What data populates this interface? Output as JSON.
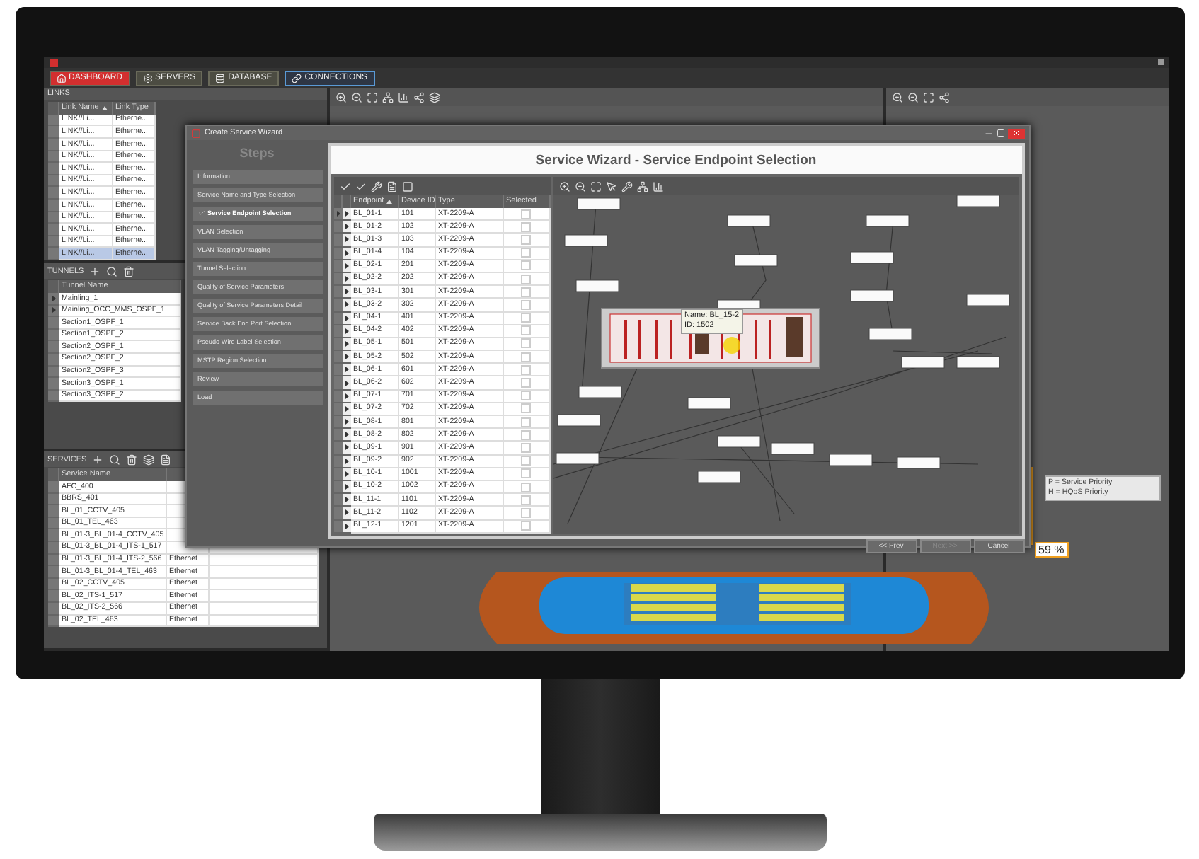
{
  "nav_tabs": [
    {
      "label": "DASHBOARD",
      "kind": "home",
      "selected": false
    },
    {
      "label": "SERVERS",
      "kind": "gear",
      "selected": false
    },
    {
      "label": "DATABASE",
      "kind": "database",
      "selected": false
    },
    {
      "label": "CONNECTIONS",
      "kind": "link",
      "selected": true
    }
  ],
  "links_panel": {
    "title": "LINKS",
    "columns": [
      "Link Name",
      "Link Type"
    ],
    "rows": [
      {
        "name": "LINK//Li...",
        "type": "Etherne...",
        "selected": false
      },
      {
        "name": "LINK//Li...",
        "type": "Etherne...",
        "selected": false
      },
      {
        "name": "LINK//Li...",
        "type": "Etherne...",
        "selected": false
      },
      {
        "name": "LINK//Li...",
        "type": "Etherne...",
        "selected": false
      },
      {
        "name": "LINK//Li...",
        "type": "Etherne...",
        "selected": false
      },
      {
        "name": "LINK//Li...",
        "type": "Etherne...",
        "selected": false
      },
      {
        "name": "LINK//Li...",
        "type": "Etherne...",
        "selected": false
      },
      {
        "name": "LINK//Li...",
        "type": "Etherne...",
        "selected": false
      },
      {
        "name": "LINK//Li...",
        "type": "Etherne...",
        "selected": false
      },
      {
        "name": "LINK//Li...",
        "type": "Etherne...",
        "selected": false
      },
      {
        "name": "LINK//Li...",
        "type": "Etherne...",
        "selected": false
      },
      {
        "name": "LINK//Li...",
        "type": "Etherne...",
        "selected": true
      }
    ]
  },
  "tunnels_panel": {
    "title": "TUNNELS",
    "columns": [
      "Tunnel Name"
    ],
    "rows": [
      {
        "name": "Mainling_1",
        "expandable": true
      },
      {
        "name": "Mainling_OCC_MMS_OSPF_1",
        "expandable": true
      },
      {
        "name": "Section1_OSPF_1",
        "expandable": false
      },
      {
        "name": "Section1_OSPF_2",
        "expandable": false
      },
      {
        "name": "Section2_OSPF_1",
        "expandable": false
      },
      {
        "name": "Section2_OSPF_2",
        "expandable": false
      },
      {
        "name": "Section2_OSPF_3",
        "expandable": false
      },
      {
        "name": "Section3_OSPF_1",
        "expandable": false
      },
      {
        "name": "Section3_OSPF_2",
        "expandable": false
      }
    ]
  },
  "services_panel": {
    "title": "SERVICES",
    "columns": [
      "Service Name"
    ],
    "rows": [
      {
        "name": "AFC_400"
      },
      {
        "name": "BBRS_401"
      },
      {
        "name": "BL_01_CCTV_405"
      },
      {
        "name": "BL_01_TEL_463"
      },
      {
        "name": "BL_01-3_BL_01-4_CCTV_405"
      },
      {
        "name": "BL_01-3_BL_01-4_ITS-1_517"
      },
      {
        "name": "BL_01-3_BL_01-4_ITS-2_566",
        "type": "Ethernet"
      },
      {
        "name": "BL_01-3_BL_01-4_TEL_463",
        "type": "Ethernet"
      },
      {
        "name": "BL_02_CCTV_405",
        "type": "Ethernet"
      },
      {
        "name": "BL_02_ITS-1_517",
        "type": "Ethernet"
      },
      {
        "name": "BL_02_ITS-2_566",
        "type": "Ethernet"
      },
      {
        "name": "BL_02_TEL_463",
        "type": "Ethernet"
      }
    ]
  },
  "legend": [
    "P = Service Priority",
    "H = HQoS Priority"
  ],
  "utilization": "59 %",
  "wizard": {
    "window_title": "Create Service Wizard",
    "steps_title": "Steps",
    "steps": [
      {
        "label": "Information",
        "checked": false
      },
      {
        "label": "Service Name and Type Selection",
        "checked": false
      },
      {
        "label": "Service Endpoint Selection",
        "checked": true
      },
      {
        "label": "VLAN Selection",
        "checked": false
      },
      {
        "label": "VLAN Tagging/Untagging",
        "checked": false
      },
      {
        "label": "Tunnel Selection",
        "checked": false
      },
      {
        "label": "Quality of Service Parameters",
        "checked": false
      },
      {
        "label": "Quality of Service Parameters Detail",
        "checked": false
      },
      {
        "label": "Service Back End Port Selection",
        "checked": false
      },
      {
        "label": "Pseudo Wire Label Selection",
        "checked": false
      },
      {
        "label": "MSTP Region Selection",
        "checked": false
      },
      {
        "label": "Review",
        "checked": false
      },
      {
        "label": "Load",
        "checked": false
      }
    ],
    "title": "Service Wizard - Service Endpoint Selection",
    "columns": [
      "Endpoint",
      "Device ID",
      "Type",
      "Selected"
    ],
    "rows": [
      {
        "endpoint": "BL_01-1",
        "device_id": "101",
        "type": "XT-2209-A",
        "selected": true,
        "checked": false
      },
      {
        "endpoint": "BL_01-2",
        "device_id": "102",
        "type": "XT-2209-A",
        "selected": false,
        "checked": false
      },
      {
        "endpoint": "BL_01-3",
        "device_id": "103",
        "type": "XT-2209-A",
        "selected": false,
        "checked": false
      },
      {
        "endpoint": "BL_01-4",
        "device_id": "104",
        "type": "XT-2209-A",
        "selected": false,
        "checked": false
      },
      {
        "endpoint": "BL_02-1",
        "device_id": "201",
        "type": "XT-2209-A",
        "selected": false,
        "checked": false
      },
      {
        "endpoint": "BL_02-2",
        "device_id": "202",
        "type": "XT-2209-A",
        "selected": false,
        "checked": false
      },
      {
        "endpoint": "BL_03-1",
        "device_id": "301",
        "type": "XT-2209-A",
        "selected": false,
        "checked": false
      },
      {
        "endpoint": "BL_03-2",
        "device_id": "302",
        "type": "XT-2209-A",
        "selected": false,
        "checked": false
      },
      {
        "endpoint": "BL_04-1",
        "device_id": "401",
        "type": "XT-2209-A",
        "selected": false,
        "checked": false
      },
      {
        "endpoint": "BL_04-2",
        "device_id": "402",
        "type": "XT-2209-A",
        "selected": false,
        "checked": false
      },
      {
        "endpoint": "BL_05-1",
        "device_id": "501",
        "type": "XT-2209-A",
        "selected": false,
        "checked": false
      },
      {
        "endpoint": "BL_05-2",
        "device_id": "502",
        "type": "XT-2209-A",
        "selected": false,
        "checked": false
      },
      {
        "endpoint": "BL_06-1",
        "device_id": "601",
        "type": "XT-2209-A",
        "selected": false,
        "checked": false
      },
      {
        "endpoint": "BL_06-2",
        "device_id": "602",
        "type": "XT-2209-A",
        "selected": false,
        "checked": false
      },
      {
        "endpoint": "BL_07-1",
        "device_id": "701",
        "type": "XT-2209-A",
        "selected": false,
        "checked": false
      },
      {
        "endpoint": "BL_07-2",
        "device_id": "702",
        "type": "XT-2209-A",
        "selected": false,
        "checked": false
      },
      {
        "endpoint": "BL_08-1",
        "device_id": "801",
        "type": "XT-2209-A",
        "selected": false,
        "checked": false
      },
      {
        "endpoint": "BL_08-2",
        "device_id": "802",
        "type": "XT-2209-A",
        "selected": false,
        "checked": false
      },
      {
        "endpoint": "BL_09-1",
        "device_id": "901",
        "type": "XT-2209-A",
        "selected": false,
        "checked": false
      },
      {
        "endpoint": "BL_09-2",
        "device_id": "902",
        "type": "XT-2209-A",
        "selected": false,
        "checked": false
      },
      {
        "endpoint": "BL_10-1",
        "device_id": "1001",
        "type": "XT-2209-A",
        "selected": false,
        "checked": false
      },
      {
        "endpoint": "BL_10-2",
        "device_id": "1002",
        "type": "XT-2209-A",
        "selected": false,
        "checked": false
      },
      {
        "endpoint": "BL_11-1",
        "device_id": "1101",
        "type": "XT-2209-A",
        "selected": false,
        "checked": false
      },
      {
        "endpoint": "BL_11-2",
        "device_id": "1102",
        "type": "XT-2209-A",
        "selected": false,
        "checked": false
      },
      {
        "endpoint": "BL_12-1",
        "device_id": "1201",
        "type": "XT-2209-A",
        "selected": false,
        "checked": false
      }
    ],
    "tooltip": {
      "name": "Name: BL_15-2",
      "id": "ID: 1502"
    },
    "buttons": [
      {
        "label": "<< Prev",
        "disabled": false
      },
      {
        "label": "Next >>",
        "disabled": true
      },
      {
        "label": "Cancel",
        "disabled": false
      }
    ]
  }
}
